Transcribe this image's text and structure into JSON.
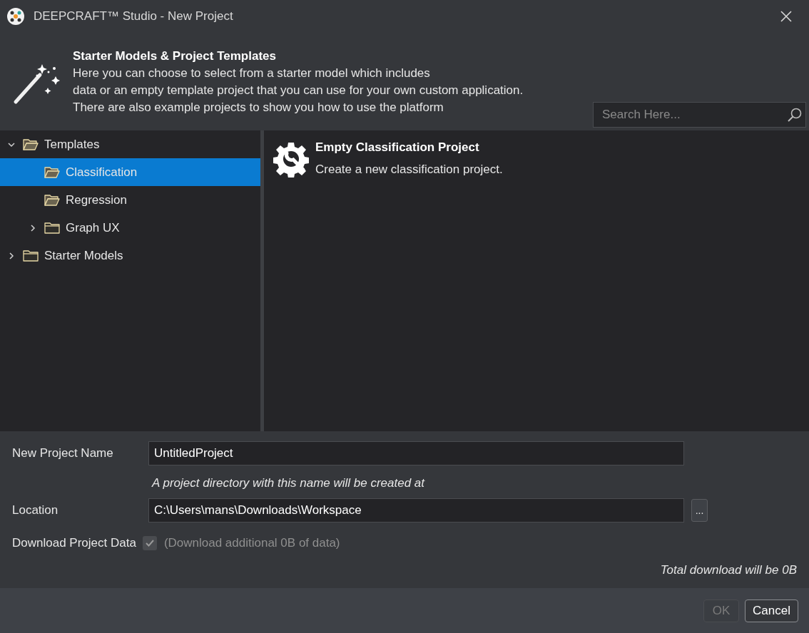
{
  "window": {
    "title": "DEEPCRAFT™ Studio - New Project"
  },
  "header": {
    "title": "Starter Models & Project Templates",
    "lines": [
      "Here you can choose to select from a starter model which includes",
      "data or an empty template project that you can use for your own custom application.",
      "There are also example projects to show you how to use the platform"
    ]
  },
  "search": {
    "placeholder": "Search Here..."
  },
  "tree": [
    {
      "label": "Templates",
      "expanded": true,
      "selected": false,
      "children": [
        {
          "label": "Classification",
          "selected": true
        },
        {
          "label": "Regression",
          "selected": false
        },
        {
          "label": "Graph UX",
          "expanded": false,
          "selected": false
        }
      ]
    },
    {
      "label": "Starter Models",
      "expanded": false,
      "selected": false
    }
  ],
  "templates": [
    {
      "title": "Empty Classification Project",
      "description": "Create a new classification project."
    }
  ],
  "form": {
    "name_label": "New Project Name",
    "name_value": "UntitledProject",
    "hint": "A project directory with this name will be created at",
    "location_label": "Location",
    "location_value": "C:\\Users\\mans\\Downloads\\Workspace",
    "browse": "...",
    "download_label": "Download Project Data",
    "download_checked": true,
    "download_disabled": true,
    "download_note": "(Download additional 0B of data)",
    "total": "Total download will be 0B"
  },
  "buttons": [
    {
      "label": "OK",
      "disabled": true
    },
    {
      "label": "Cancel",
      "disabled": false
    }
  ]
}
